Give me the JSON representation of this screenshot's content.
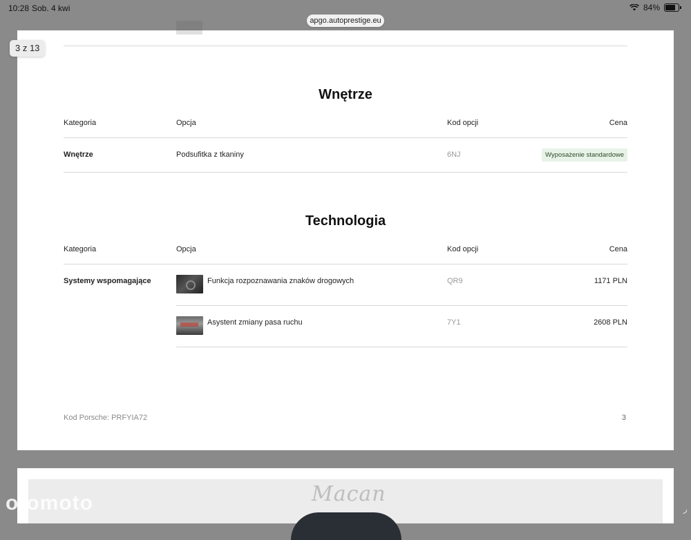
{
  "statusbar": {
    "time": "10:28",
    "date": "Sob. 4 kwi",
    "battery": "84%"
  },
  "browser": {
    "url": "apgo.autoprestige.eu"
  },
  "viewer": {
    "page_indicator": "3 z 13"
  },
  "sections": {
    "wnetrze": {
      "title": "Wnętrze",
      "headers": {
        "kategoria": "Kategoria",
        "opcja": "Opcja",
        "kod": "Kod opcji",
        "cena": "Cena"
      },
      "rows": [
        {
          "kategoria": "Wnętrze",
          "opcja": "Podsufitka z tkaniny",
          "kod": "6NJ",
          "cena": "Wyposażenie standardowe"
        }
      ]
    },
    "technologia": {
      "title": "Technologia",
      "headers": {
        "kategoria": "Kategoria",
        "opcja": "Opcja",
        "kod": "Kod opcji",
        "cena": "Cena"
      },
      "rows": [
        {
          "kategoria": "Systemy wspomagające",
          "opcja": "Funkcja rozpoznawania znaków drogowych",
          "kod": "QR9",
          "cena": "1171 PLN"
        },
        {
          "kategoria": "",
          "opcja": "Asystent zmiany pasa ruchu",
          "kod": "7Y1",
          "cena": "2608 PLN"
        }
      ]
    }
  },
  "footer": {
    "code": "Kod Porsche: PRFYIA72",
    "page_number": "3"
  },
  "next_page": {
    "logo_text": "Macan"
  },
  "watermark": "otomoto"
}
